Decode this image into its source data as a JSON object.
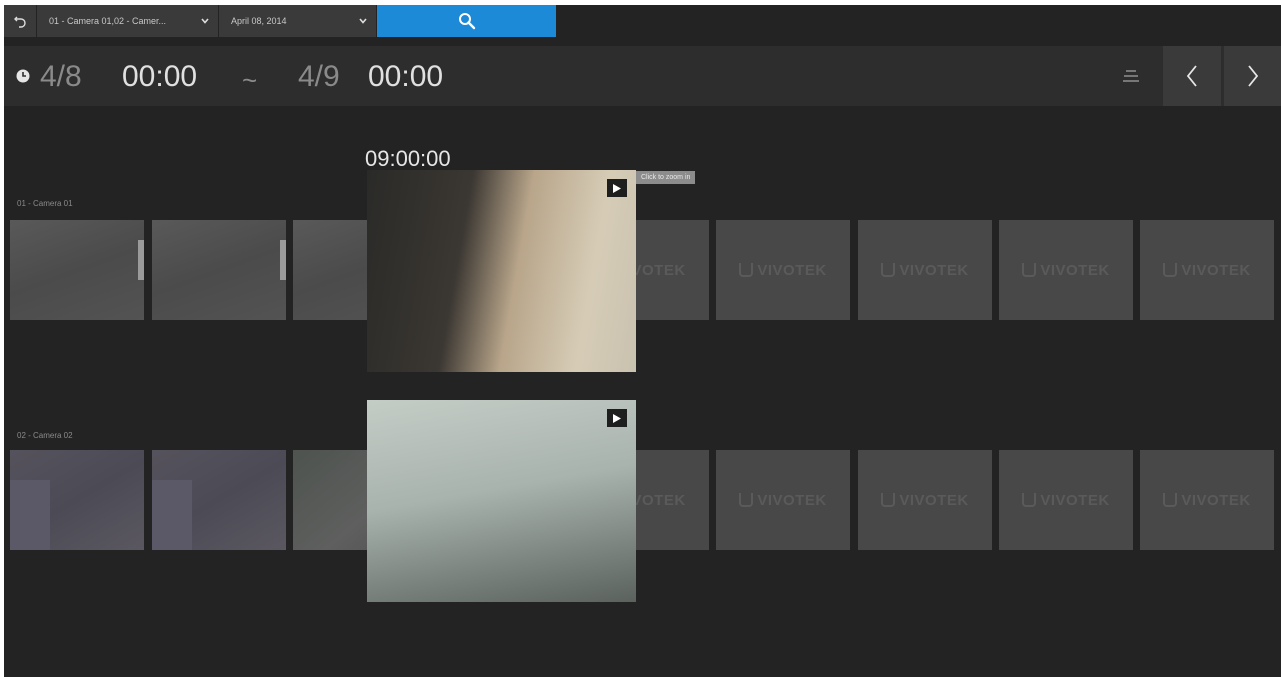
{
  "toolbar": {
    "camera_select": "01 - Camera 01,02 - Camer...",
    "date_select": "April 08, 2014"
  },
  "time_range": {
    "start_date": "4/8",
    "start_time": "00:00",
    "separator": "~",
    "end_date": "4/9",
    "end_time": "00:00"
  },
  "current_time": "09:00:00",
  "tooltip": "Click to zoom in",
  "cameras": [
    {
      "label": "01 - Camera 01"
    },
    {
      "label": "02 - Camera 02"
    }
  ],
  "logo_text": "VIVOTEK",
  "colors": {
    "accent": "#1c8ad6",
    "background": "#232323",
    "toolbar": "#3a3a3a"
  },
  "icons": [
    "back-icon",
    "chevron-down-icon",
    "search-icon",
    "clock-icon",
    "list-view-icon",
    "chevron-left-icon",
    "chevron-right-icon",
    "play-icon",
    "vivotek-logo-icon"
  ]
}
